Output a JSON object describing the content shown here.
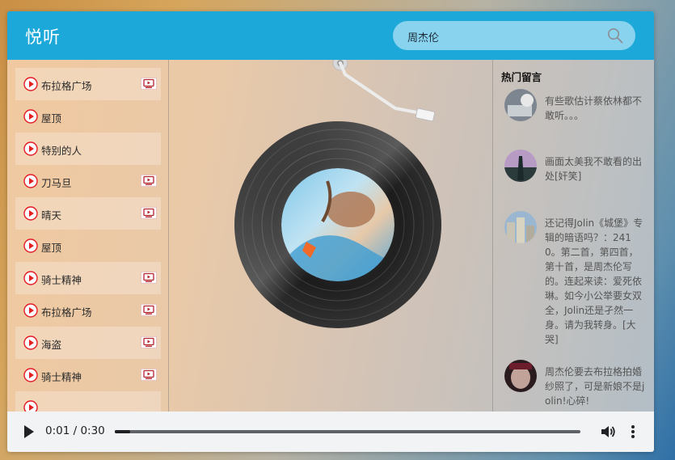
{
  "header": {
    "logo": "悦听",
    "search": {
      "value": "周杰伦"
    }
  },
  "colors": {
    "header": "#1ca9da",
    "search_box": "#8ad3ee",
    "play_icon": "#e31b23",
    "mv_icon": "#b3232d"
  },
  "playlist": {
    "items": [
      {
        "title": "布拉格广场",
        "has_mv": true
      },
      {
        "title": "屋顶",
        "has_mv": false
      },
      {
        "title": "特别的人",
        "has_mv": false
      },
      {
        "title": "刀马旦",
        "has_mv": true
      },
      {
        "title": "晴天",
        "has_mv": true
      },
      {
        "title": "屋顶",
        "has_mv": false
      },
      {
        "title": "骑士精神",
        "has_mv": true
      },
      {
        "title": "布拉格广场",
        "has_mv": true
      },
      {
        "title": "海盗",
        "has_mv": true
      },
      {
        "title": "骑士精神",
        "has_mv": true
      },
      {
        "title": "",
        "has_mv": false
      }
    ],
    "icons": {
      "play": "play-circle-icon",
      "mv": "mv-icon"
    }
  },
  "comments": {
    "title": "热门留言",
    "items": [
      {
        "text": "有些歌估计蔡依林都不敢听。。。"
      },
      {
        "text": "画面太美我不敢看的出处[奸笑]"
      },
      {
        "text": "还记得Jolin《城堡》专辑的暗语吗？：2410。第二首，第四首，第十首，是周杰伦写的。连起来读：爱死依琳。如今小公举要女双全，Jolin还是孑然一身。请为我转身。[大哭]"
      },
      {
        "text": "周杰伦要去布拉格拍婚纱照了，可是新娘不是jolin!心碎!"
      }
    ]
  },
  "player": {
    "time": "0:01 / 0:30",
    "progress": 0.033
  }
}
